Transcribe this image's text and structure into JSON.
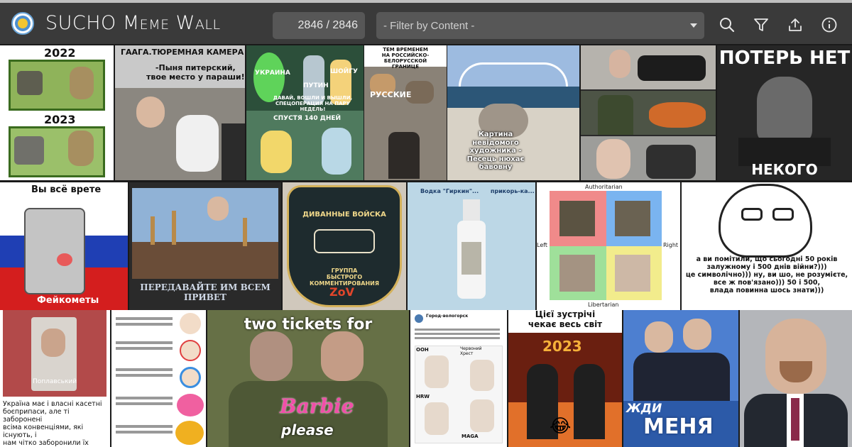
{
  "app": {
    "title": "SUCHO Meme Wall",
    "logo": "sucho-logo"
  },
  "toolbar": {
    "counter": "2846 / 2846",
    "filter_placeholder": "- Filter by Content -",
    "icons": [
      "search-icon",
      "filter-icon",
      "upload-icon",
      "info-icon"
    ]
  },
  "colors": {
    "appbar": "#3a3a3a",
    "field": "#575757",
    "topstrip": "#bfbfbf"
  },
  "memes": {
    "m1": {
      "top": "2022",
      "bottom": "2023"
    },
    "m2": {
      "title": "ГААГА.ТЮРЕМНАЯ КАМЕРА",
      "quote": "-Пыня питерский,\nтвое место у параши!"
    },
    "m3": {
      "l1": "УКРАИНА",
      "l2": "ПУТИН",
      "l3": "ШОЙГУ",
      "l4": "ДАВАЙ, ВОШЛИ И ВЫШЛИ,\nСПЕЦОПЕРАЦИЯ НА ПАРУ НЕДЕЛЬ!",
      "l5": "СПУСТЯ 140 ДНЕЙ"
    },
    "m4": {
      "title": "ТЕМ ВРЕМЕНЕМ\nНА РОССИЙСКО-БЕЛОРУССКОЙ\nГРАНИЦЕ",
      "label": "РУССКИЕ"
    },
    "m5": {
      "caption": "Картина\nневідомого\nхудожника -\nПесець нюхає\nбавовну"
    },
    "m7": {
      "top": "ПОТЕРЬ НЕТ",
      "bottom": "НЕКОГО ТЕРЯТЬ"
    },
    "m8": {
      "top": "Вы всё врете",
      "bottom": "Фейкометы"
    },
    "m9": {
      "caption": "ПЕРЕДАВАЙТЕ ИМ ВСЕМ\nПРИВЕТ"
    },
    "m10": {
      "top": "ДИВАННЫЕ ВОЙСКА",
      "mid": "ГРУППА\nБЫСТРОГО\nКОММЕНТИРОВАНИЯ",
      "bottom": "ZoV"
    },
    "m11": {
      "top": "Водка \"Гиркин\"...      прикорь-ка..."
    },
    "m12": {
      "top": "Authoritarian",
      "left": "Left",
      "right": "Right",
      "bottom": "Libertarian"
    },
    "m13": {
      "caption": "а ви помітили, що сьогодні 50 років\nзалужному і 500 днів війни?)))\nце символічно))) ну, ви шо, не розумієте,\nвсе ж пов'язано))) 50 і 500,\nвлада повинна шось знати)))"
    },
    "m14": {
      "tape": "Поплавський",
      "caption": "Україна має і власні касетні\nбоєприпаси, але ті заборонені\nвсіма конвенціями, які існують, і\nнам чітко заборонили їх\nвикористовувати."
    },
    "m16": {
      "top": "two tickets for",
      "brand": "Barbie",
      "bottom": "please"
    },
    "m17": {
      "account": "Город-вологорск",
      "ooh": "ООН",
      "cross": "Червоний\nХрест",
      "hrw": "HRW",
      "maga": "MAGA"
    },
    "m18": {
      "top": "Цієї зустрічі\nчекає весь світ",
      "year": "2023",
      "emoji": "😂"
    },
    "m19": {
      "banner": "ЖДИ",
      "big": "МЕНЯ"
    }
  }
}
